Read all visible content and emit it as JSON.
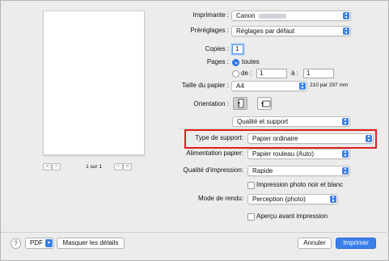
{
  "preview": {
    "page_indicator": "1 sur 1",
    "first_glyph": "«",
    "prev_glyph": "‹",
    "next_glyph": "›",
    "last_glyph": "»"
  },
  "printer": {
    "label": "Imprimante :",
    "value": "Canon"
  },
  "presets": {
    "label": "Préréglages :",
    "value": "Réglages par défaut"
  },
  "copies": {
    "label": "Copies :",
    "value": "1"
  },
  "pages": {
    "label": "Pages :",
    "all_label": "toutes",
    "from_label": "de :",
    "from_value": "1",
    "to_label": "à :",
    "to_value": "1"
  },
  "paper_size": {
    "label": "Taille du papier :",
    "value": "A4",
    "dimensions": "210 par 297 mm"
  },
  "orientation": {
    "label": "Orientation :",
    "portrait_glyph": "↑",
    "landscape_glyph": "↑"
  },
  "section": {
    "value": "Qualité et support"
  },
  "media_type": {
    "label": "Type de support:",
    "value": "Papier ordinaire"
  },
  "paper_source": {
    "label": "Alimentation papier:",
    "value": "Papier rouleau (Auto)"
  },
  "print_quality": {
    "label": "Qualité d'impression:",
    "value": "Rapide"
  },
  "grayscale": {
    "label": "Impression photo noir et blanc"
  },
  "render_mode": {
    "label": "Mode de rendu:",
    "value": "Perception (photo)"
  },
  "preview_check": {
    "label": "Aperçu avant impression"
  },
  "footer": {
    "help": "?",
    "pdf": "PDF",
    "pdf_arrow": "▾",
    "hide_details": "Masquer les détails",
    "cancel": "Annuler",
    "print": "Imprimer"
  },
  "colors": {
    "accent": "#3a7fea",
    "highlight": "#e0201f"
  }
}
